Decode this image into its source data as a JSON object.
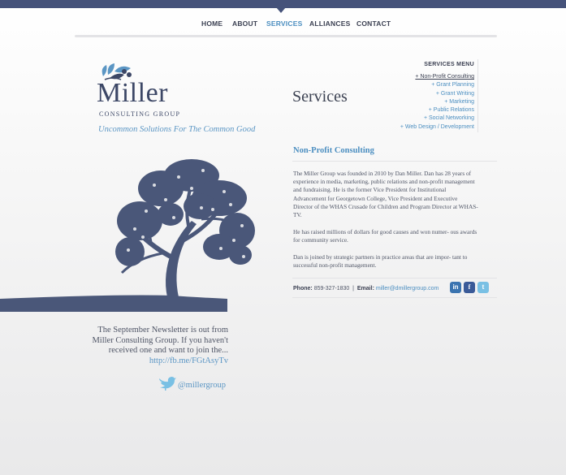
{
  "nav": {
    "items": [
      "HOME",
      "ABOUT",
      "SERVICES",
      "ALLIANCES",
      "CONTACT"
    ],
    "active": "SERVICES"
  },
  "logo": {
    "word": "Miller",
    "sub": "CONSULTING GROUP",
    "tagline": "Uncommon Solutions For The Common Good"
  },
  "page": {
    "heading": "Services"
  },
  "services_menu": {
    "title": "SERVICES MENU",
    "items": [
      "+ Non-Profit Consulting",
      "+ Grant Planning",
      "+ Grant Writing",
      "+ Marketing",
      "+ Public Relations",
      "+ Social Networking",
      "+ Web Design / Development"
    ]
  },
  "content": {
    "title": "Non-Profit Consulting",
    "paragraph1": "The Miller Group was founded in 2010 by Dan Miller. Dan has 28 years of experience in media, marketing, public relations and non-profit management and fundraising.   He is the former Vice President for Institutional  Advancement for  Georgetown College, Vice President and  Executive Director of the WHAS Crusade  for Children and Program Director at WHAS-TV.",
    "paragraph2": "He has raised millions of dollars for good causes and won numer- ous awards for community service.",
    "paragraph3": "Dan is joined by strategic partners in practice areas that are impor- tant to successful non-profit management."
  },
  "contact": {
    "phone_label": "Phone:",
    "phone": "859-327-1830",
    "separator": "|",
    "email_label": "Email:",
    "email": "miller@dmillergroup.com"
  },
  "social": {
    "linkedin": "in",
    "facebook": "f",
    "twitter": "t"
  },
  "newsletter": {
    "text": "The September Newsletter is out from Miller Consulting Group. If you haven't received one and want to join the...",
    "link": "http://fb.me/FGtAsyTv",
    "twitter_handle": "@millergroup"
  },
  "colors": {
    "navy": "#45527a",
    "accent_blue": "#4b8ec0",
    "tree": "#4a5779"
  }
}
